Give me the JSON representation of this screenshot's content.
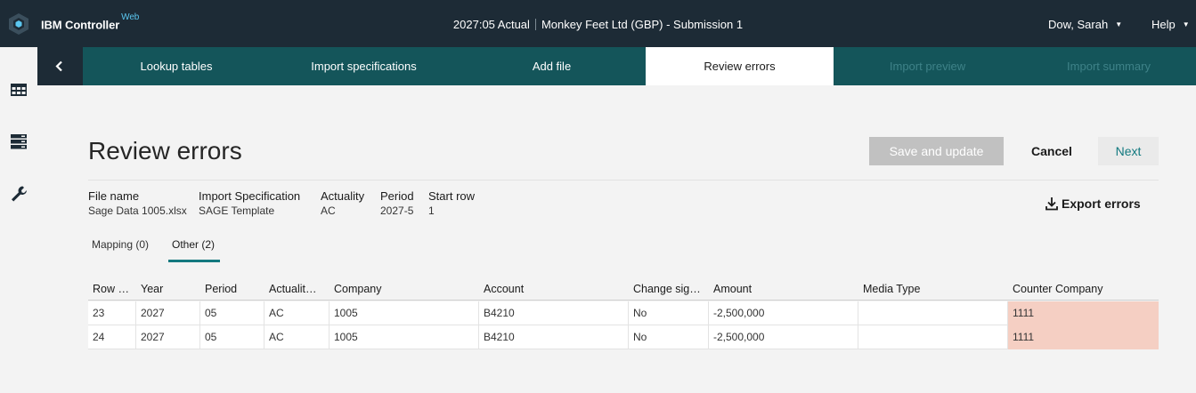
{
  "app": {
    "brand_main": "IBM Controller",
    "brand_sup": "Web"
  },
  "context": {
    "period": "2027:05 Actual",
    "company": "Monkey Feet Ltd (GBP) - Submission 1"
  },
  "user": {
    "name": "Dow, Sarah",
    "help": "Help"
  },
  "wizard": {
    "tabs": [
      {
        "label": "Lookup tables",
        "state": "done"
      },
      {
        "label": "Import specifications",
        "state": "done"
      },
      {
        "label": "Add file",
        "state": "done"
      },
      {
        "label": "Review errors",
        "state": "active"
      },
      {
        "label": "Import preview",
        "state": "disabled"
      },
      {
        "label": "Import summary",
        "state": "disabled"
      }
    ]
  },
  "page": {
    "title": "Review errors"
  },
  "actions": {
    "save": "Save and update",
    "cancel": "Cancel",
    "next": "Next",
    "export": "Export errors"
  },
  "meta": [
    {
      "key": "File name",
      "value": "Sage Data 1005.xlsx"
    },
    {
      "key": "Import Specification",
      "value": "SAGE Template"
    },
    {
      "key": "Actuality",
      "value": "AC"
    },
    {
      "key": "Period",
      "value": "2027-5"
    },
    {
      "key": "Start row",
      "value": "1"
    }
  ],
  "subtabs": [
    {
      "label": "Mapping (0)",
      "active": false
    },
    {
      "label": "Other (2)",
      "active": true
    }
  ],
  "table": {
    "columns": [
      "Row …",
      "Year",
      "Period",
      "Actualit…",
      "Company",
      "Account",
      "Change sig…",
      "Amount",
      "Media Type",
      "Counter Company"
    ],
    "rows": [
      [
        "23",
        "2027",
        "05",
        "AC",
        "1005",
        "B4210",
        "No",
        "-2,500,000",
        "",
        "1111"
      ],
      [
        "24",
        "2027",
        "05",
        "AC",
        "1005",
        "B4210",
        "No",
        "-2,500,000",
        "",
        "1111"
      ]
    ],
    "error_column": "Counter Company"
  },
  "colors": {
    "topbar": "#1d2b36",
    "wizard": "#14555a",
    "accent": "#14797f",
    "error_cell": "#f5cfc3"
  },
  "icons": [
    "app-logo-icon",
    "grid-icon",
    "server-icon",
    "wrench-icon",
    "chevron-left-icon",
    "download-icon"
  ]
}
